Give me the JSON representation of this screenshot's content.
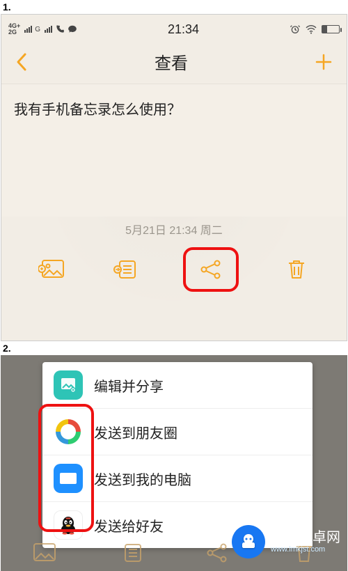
{
  "steps": {
    "one": "1.",
    "two": "2."
  },
  "status": {
    "net_top": "4G+",
    "net_bot": "2G",
    "net_g": "G",
    "time": "21:34"
  },
  "nav": {
    "title": "查看"
  },
  "note": {
    "text": "我有手机备忘录怎么使用？"
  },
  "timestamp": "5月21日 21:34 周二",
  "sheet": {
    "edit": "编辑并分享",
    "moments": "发送到朋友圈",
    "pc": "发送到我的电脑",
    "qq": "发送给好友"
  },
  "watermark": {
    "title": "蓝莓安卓网",
    "url": "www.lmkjst.com"
  }
}
